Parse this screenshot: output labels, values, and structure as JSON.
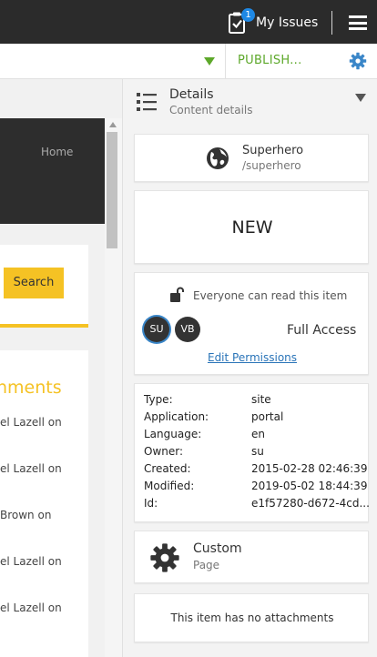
{
  "topbar": {
    "issues_label": "My Issues",
    "issues_count": "1",
    "menu_icon": "hamburger-icon"
  },
  "toolbar": {
    "publish_label": "PUBLISH...",
    "settings_icon": "gear-icon",
    "accent_color": "#5da82a"
  },
  "left": {
    "nav_home": "Home",
    "search_button": "Search",
    "comments_title": "nments",
    "comments": [
      "el Lazell on",
      "el Lazell on",
      "Brown on",
      "el Lazell on",
      "el Lazell on"
    ],
    "accent_color": "#f5c224"
  },
  "panel": {
    "title": "Details",
    "subtitle": "Content details",
    "site": {
      "name": "Superhero",
      "path": "/superhero"
    },
    "status": "NEW",
    "permissions": {
      "summary": "Everyone can read this item",
      "avatars": [
        "SU",
        "VB"
      ],
      "access": "Full Access",
      "edit_link": "Edit Permissions"
    },
    "properties": [
      {
        "key": "Type:",
        "value": "site"
      },
      {
        "key": "Application:",
        "value": "portal"
      },
      {
        "key": "Language:",
        "value": "en"
      },
      {
        "key": "Owner:",
        "value": "su"
      },
      {
        "key": "Created:",
        "value": "2015-02-28 02:46:39"
      },
      {
        "key": "Modified:",
        "value": "2019-05-02 18:44:39"
      },
      {
        "key": "Id:",
        "value": "e1f57280-d672-4cd..."
      }
    ],
    "content_type": {
      "name": "Custom",
      "sub": "Page"
    },
    "attachments_text": "This item has no attachments"
  }
}
